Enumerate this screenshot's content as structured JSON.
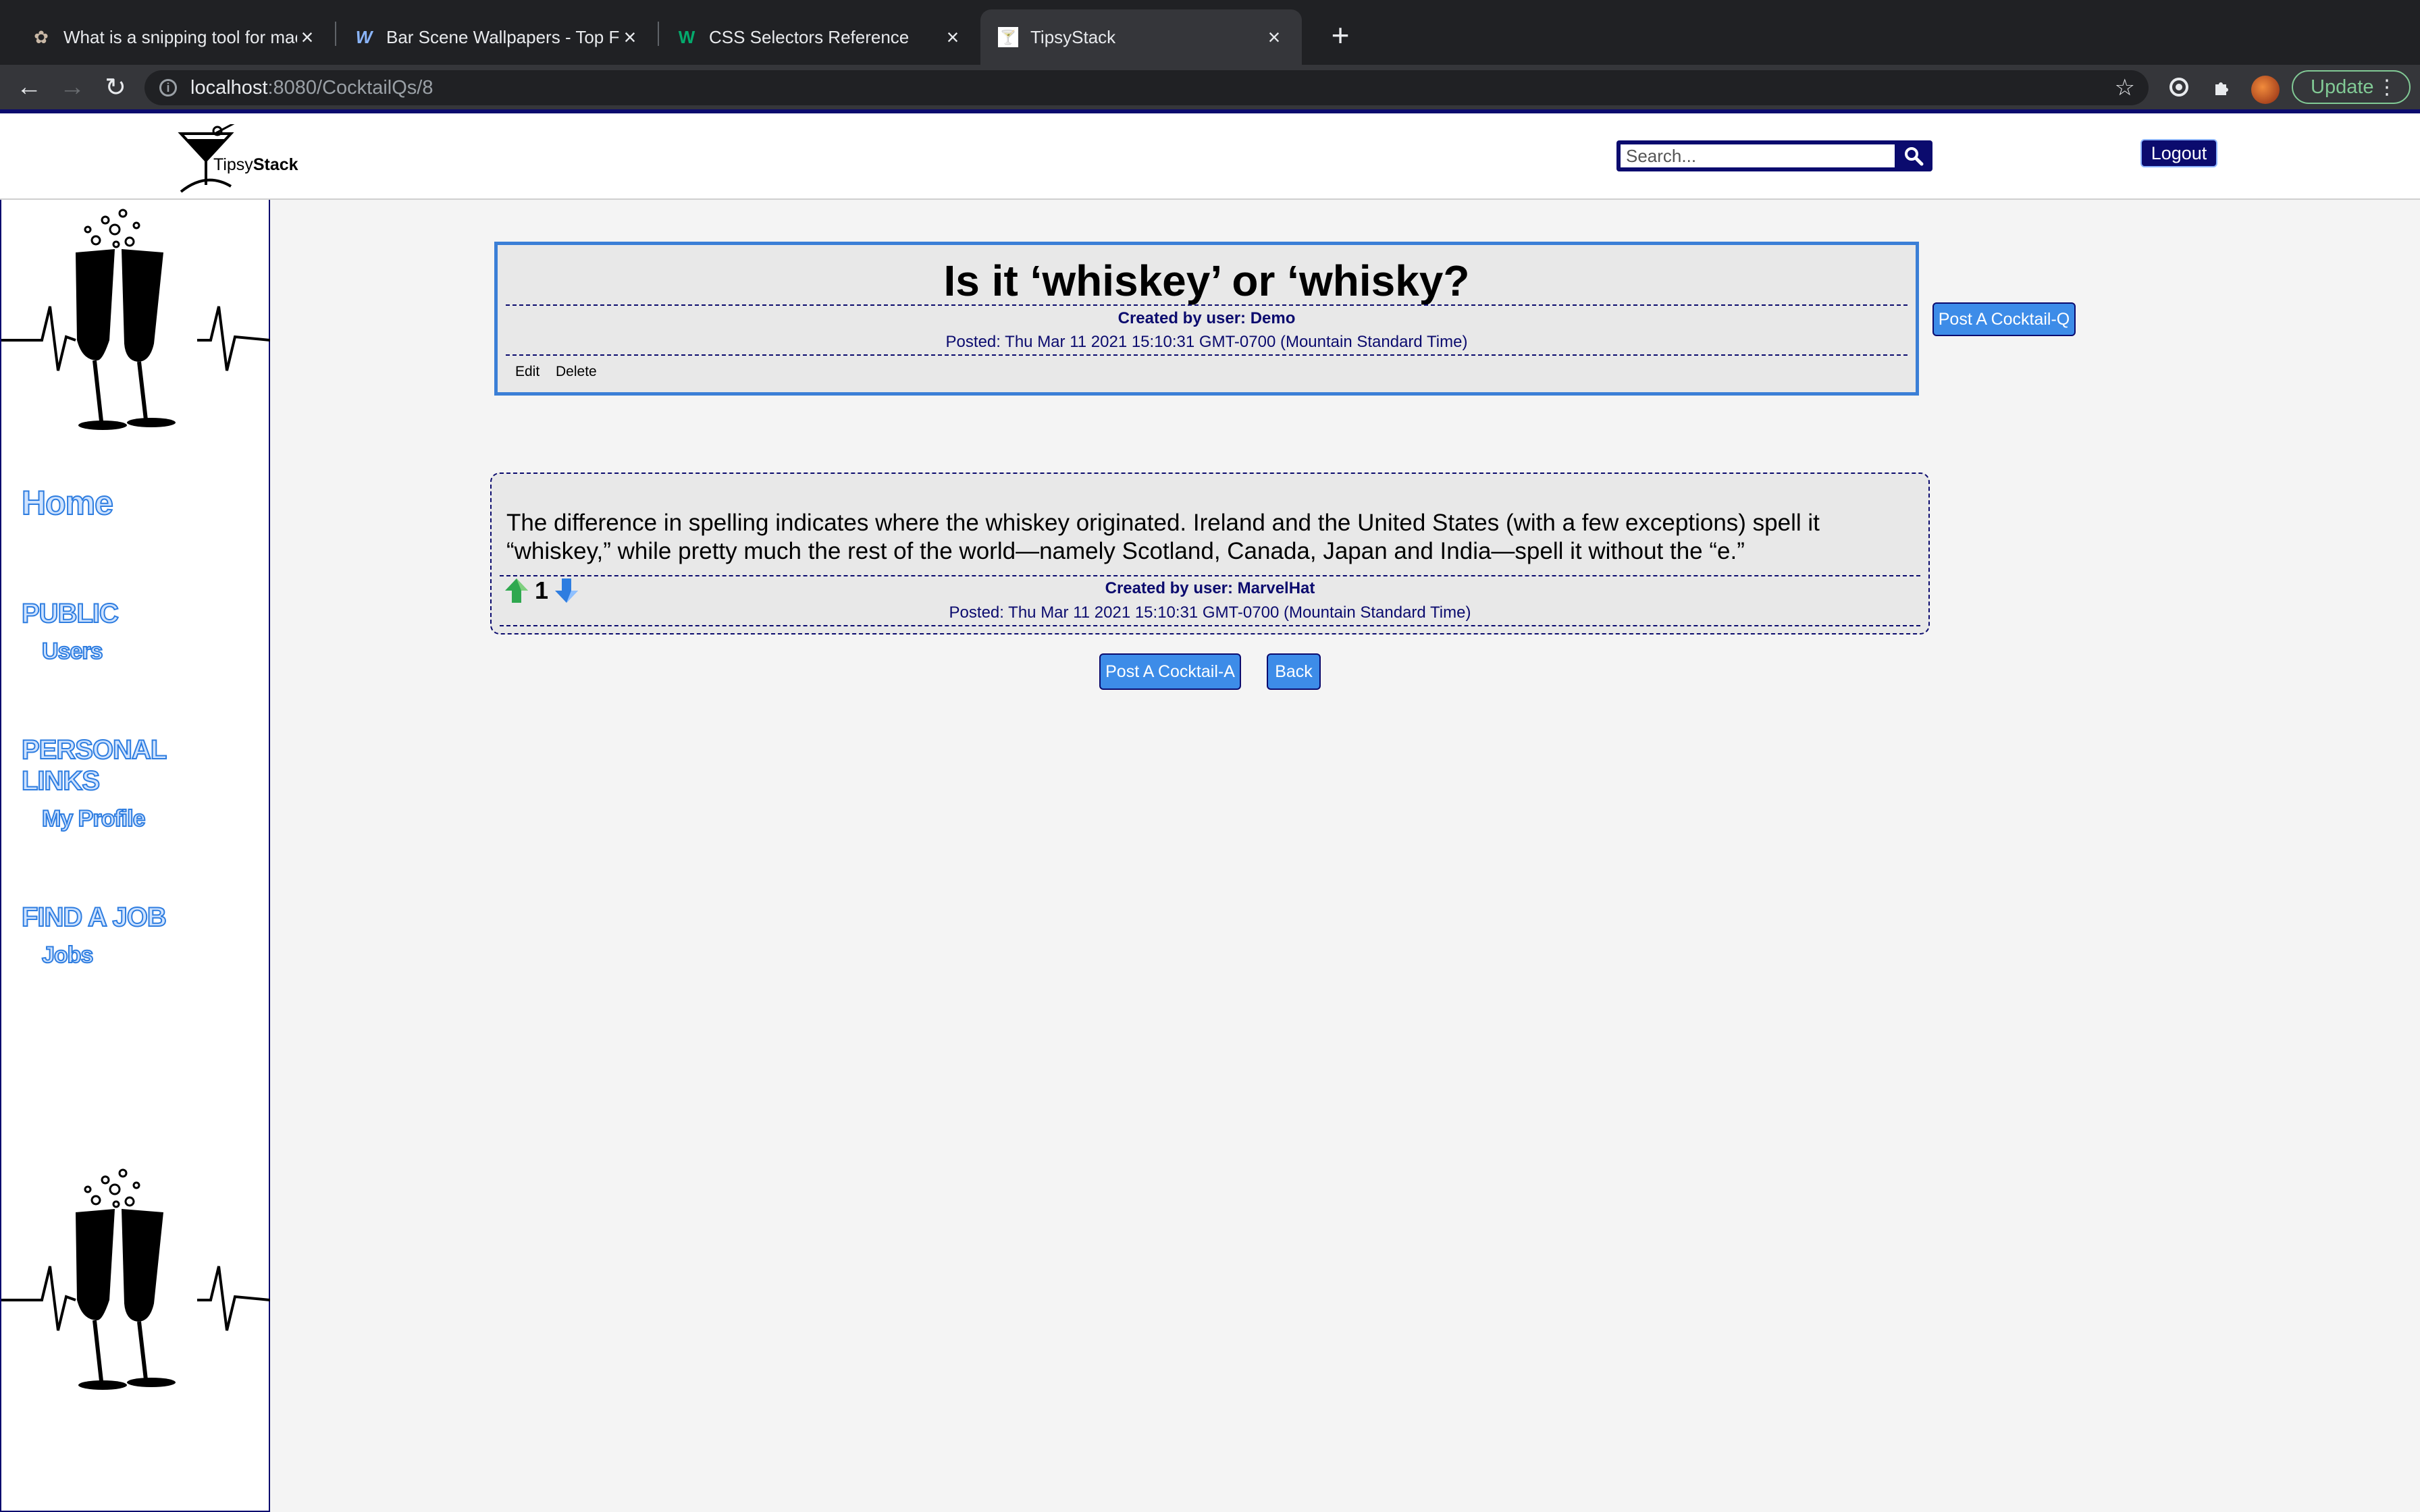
{
  "browser": {
    "tabs": [
      {
        "title": "What is a snipping tool for mac",
        "favicon": "snip-favicon"
      },
      {
        "title": "Bar Scene Wallpapers - Top Fre",
        "favicon": "wallpaper-favicon"
      },
      {
        "title": "CSS Selectors Reference",
        "favicon": "w3-favicon"
      },
      {
        "title": "TipsyStack",
        "favicon": "tipsystack-favicon",
        "active": true
      }
    ],
    "url_host": "localhost",
    "url_path": ":8080/CocktailQs/8",
    "update_label": "Update"
  },
  "site": {
    "logo_text_plain": "Tipsy",
    "logo_text_bold": "Stack",
    "search_placeholder": "Search...",
    "logout_label": "Logout"
  },
  "sidebar": {
    "home": "Home",
    "public_heading": "PUBLIC",
    "users": "Users",
    "personal_heading_1": "PERSONAL",
    "personal_heading_2": "LINKS",
    "my_profile": "My Profile",
    "job_heading": "FIND A JOB",
    "jobs": "Jobs"
  },
  "question": {
    "title": "Is it ‘whiskey’ or ‘whisky?",
    "created_by": "Created by user: Demo",
    "posted": "Posted: Thu Mar 11 2021 15:10:31 GMT-0700 (Mountain Standard Time)",
    "edit_label": "Edit",
    "delete_label": "Delete"
  },
  "post_question_label": "Post A Cocktail-Q",
  "answer": {
    "body": "The difference in spelling indicates where the whiskey originated. Ireland and the United States (with a few exceptions) spell it “whiskey,” while pretty much the rest of the world—namely Scotland, Canada, Japan and India—spell it without the “e.”",
    "votes": "1",
    "created_by": "Created by user: MarvelHat",
    "posted": "Posted: Thu Mar 11 2021 15:10:31 GMT-0700 (Mountain Standard Time)"
  },
  "buttons": {
    "post_answer": "Post A Cocktail-A",
    "back": "Back"
  },
  "colors": {
    "navy": "#0b0b6e",
    "button_blue": "#3d8ce8",
    "border_blue": "#3b7fd6",
    "upvote_green": "#2fa84f",
    "downvote_blue": "#2e7de0"
  }
}
